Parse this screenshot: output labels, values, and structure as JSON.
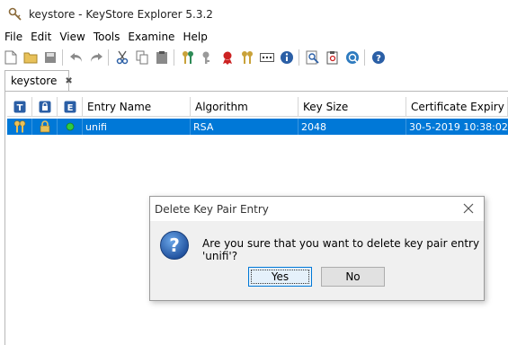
{
  "window": {
    "title": "keystore - KeyStore Explorer 5.3.2",
    "app_icon": "keystore-explorer-icon"
  },
  "menu": [
    "File",
    "Edit",
    "View",
    "Tools",
    "Examine",
    "Help"
  ],
  "toolbar": {
    "buttons": [
      "new-icon",
      "open-icon",
      "save-icon",
      "undo-icon",
      "redo-icon",
      "cut-icon",
      "copy-icon",
      "paste-icon",
      "generate-key-pair-icon",
      "generate-secret-key-icon",
      "import-trusted-certificate-icon",
      "import-key-pair-icon",
      "set-password-icon",
      "properties-icon",
      "examine-file-icon",
      "examine-clipboard-icon",
      "examine-ssl-icon",
      "help-icon"
    ]
  },
  "tabs": [
    {
      "label": "keystore",
      "close": "✖"
    }
  ],
  "table": {
    "icon_headers": [
      "T",
      "lock",
      "E"
    ],
    "headers": [
      "Entry Name",
      "Algorithm",
      "Key Size",
      "Certificate Expiry"
    ],
    "rows": [
      {
        "type_icon": "key-pair-icon",
        "lock_icon": "lock-icon",
        "status_icon": "status-ok-icon",
        "entry_name": "unifi",
        "algorithm": "RSA",
        "key_size": "2048",
        "expiry": "30-5-2019 10:38:02 ..."
      }
    ]
  },
  "dialog": {
    "title": "Delete Key Pair Entry",
    "message": "Are you sure that you want to delete key pair entry 'unifi'?",
    "yes_label": "Yes",
    "no_label": "No"
  },
  "colors": {
    "selection": "#0078d7",
    "status_green": "#2ecc40",
    "icon_blue": "#2b5fa6",
    "key_gold": "#c9a23a"
  }
}
